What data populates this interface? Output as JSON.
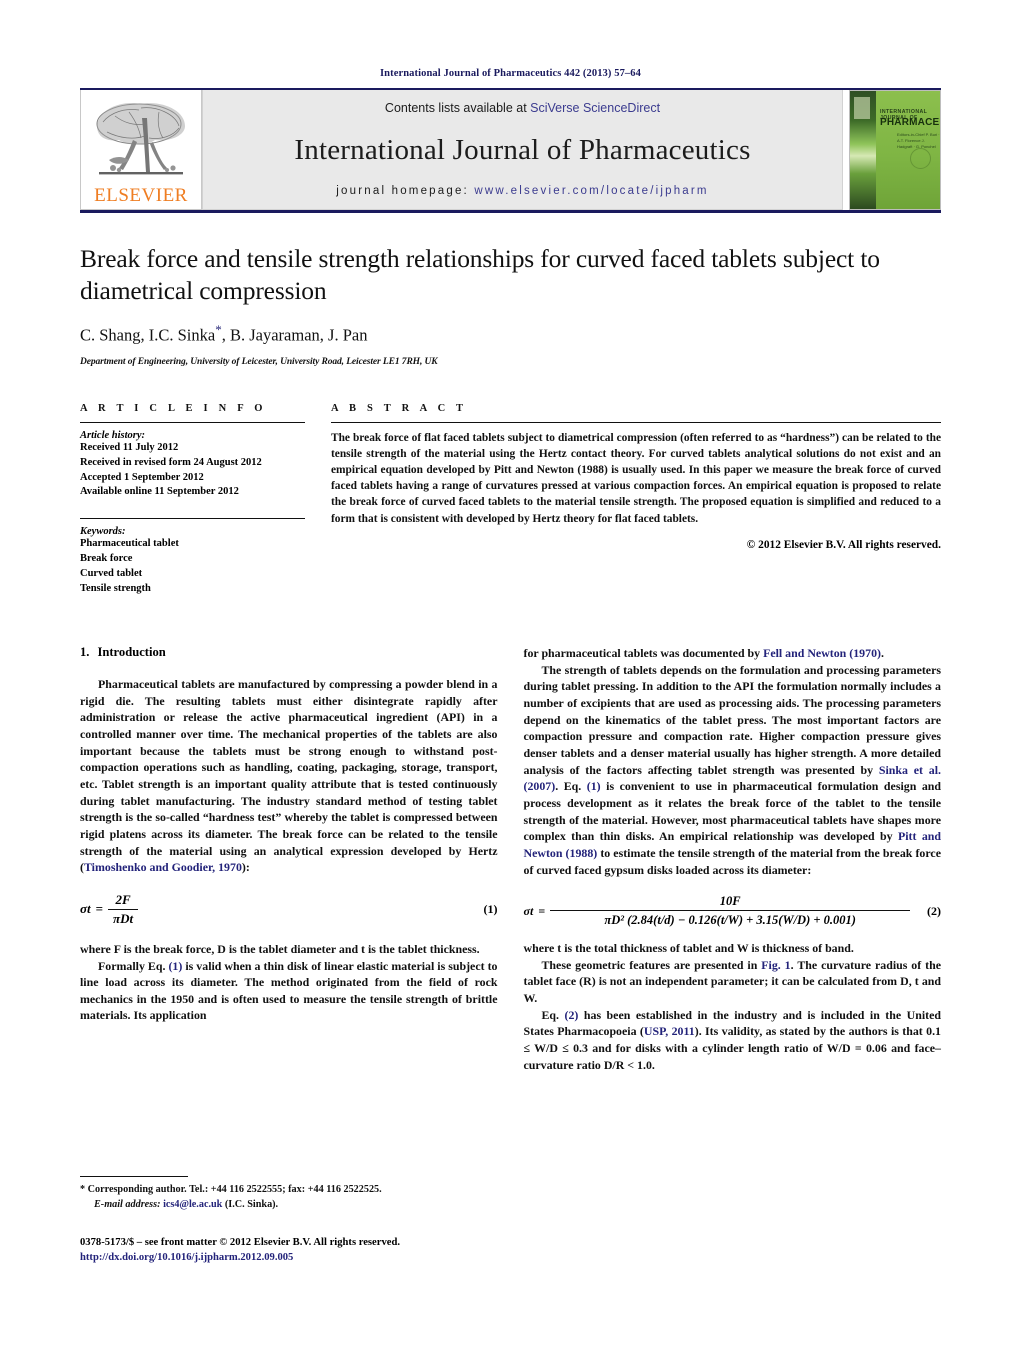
{
  "running_head": "International Journal of Pharmaceutics 442 (2013) 57–64",
  "masthead": {
    "contents_prefix": "Contents lists available at ",
    "contents_link": "SciVerse ScienceDirect",
    "journal_title": "International Journal of Pharmaceutics",
    "homepage_prefix": "journal homepage: ",
    "homepage_url": "www.elsevier.com/locate/ijpharm",
    "publisher_wordmark": "ELSEVIER",
    "cover": {
      "line1": "INTERNATIONAL JOURNAL OF",
      "line2": "PHARMACEUTICS",
      "line3": "Editors-in-Chief\nP. Buri · A.T. Florence\nJ. Hadgraft · G. Ponchel"
    },
    "link_color": "#3b3b8f",
    "rule_color": "#1a1a5e"
  },
  "title": "Break force and tensile strength relationships for curved faced tablets subject to diametrical compression",
  "authors": "C. Shang, I.C. Sinka",
  "authors_tail": ", B. Jayaraman, J. Pan",
  "corresponding_marker": "*",
  "affiliation": "Department of Engineering, University of Leicester, University Road, Leicester LE1 7RH, UK",
  "article_info": {
    "heading": "A R T I C L E   I N F O",
    "history_label": "Article history:",
    "history": [
      "Received 11 July 2012",
      "Received in revised form 24 August 2012",
      "Accepted 1 September 2012",
      "Available online 11 September 2012"
    ],
    "keywords_label": "Keywords:",
    "keywords": [
      "Pharmaceutical tablet",
      "Break force",
      "Curved tablet",
      "Tensile strength"
    ]
  },
  "abstract": {
    "heading": "A B S T R A C T",
    "text": "The break force of flat faced tablets subject to diametrical compression (often referred to as “hardness”) can be related to the tensile strength of the material using the Hertz contact theory. For curved tablets analytical solutions do not exist and an empirical equation developed by Pitt and Newton (1988) is usually used. In this paper we measure the break force of curved faced tablets having a range of curvatures pressed at various compaction forces. An empirical equation is proposed to relate the break force of curved faced tablets to the material tensile strength. The proposed equation is simplified and reduced to a form that is consistent with developed by Hertz theory for flat faced tablets.",
    "copyright": "© 2012 Elsevier B.V. All rights reserved."
  },
  "body": {
    "section_number": "1.",
    "section_title": "Introduction",
    "left": {
      "p1": "Pharmaceutical tablets are manufactured by compressing a powder blend in a rigid die. The resulting tablets must either disintegrate rapidly after administration or release the active pharmaceutical ingredient (API) in a controlled manner over time. The mechanical properties of the tablets are also important because the tablets must be strong enough to withstand post-compaction operations such as handling, coating, packaging, storage, transport, etc. Tablet strength is an important quality attribute that is tested continuously during tablet manufacturing. The industry standard method of testing tablet strength is the so-called “hardness test” whereby the tablet is compressed between rigid platens across its diameter. The break force can be related to the tensile strength of the material using an analytical expression developed by Hertz (",
      "p1_ref": "Timoshenko and Goodier, 1970",
      "p1_tail": "):",
      "eq1": {
        "lhs": "σt",
        "eq": "=",
        "numerator": "2F",
        "denominator": "πDt",
        "number": "(1)"
      },
      "p2": "where F is the break force, D is the tablet diameter and t is the tablet thickness.",
      "p3_head": "Formally Eq. ",
      "p3_ref": "(1)",
      "p3": " is valid when a thin disk of linear elastic material is subject to line load across its diameter. The method originated from the field of rock mechanics in the 1950 and is often used to measure the tensile strength of brittle materials. Its application"
    },
    "right": {
      "p1_head": "for pharmaceutical tablets was documented by ",
      "p1_ref": "Fell and Newton (1970)",
      "p1_tail": ".",
      "p2_a": "The strength of tablets depends on the formulation and processing parameters during tablet pressing. In addition to the API the formulation normally includes a number of excipients that are used as processing aids. The processing parameters depend on the kinematics of the tablet press. The most important factors are compaction pressure and compaction rate. Higher compaction pressure gives denser tablets and a denser material usually has higher strength. A more detailed analysis of the factors affecting tablet strength was presented by ",
      "p2_ref1": "Sinka et al. (2007)",
      "p2_b": ". Eq. ",
      "p2_ref2": "(1)",
      "p2_c": " is convenient to use in pharmaceutical formulation design and process development as it relates the break force of the tablet to the tensile strength of the material. However, most pharmaceutical tablets have shapes more complex than thin disks. An empirical relationship was developed by ",
      "p2_ref3": "Pitt and Newton (1988)",
      "p2_d": " to estimate the tensile strength of the material from the break force of curved faced gypsum disks loaded across its diameter:",
      "eq2": {
        "lhs": "σt",
        "eq": "=",
        "numerator": "10F",
        "denominator": "πD² (2.84(t/d) − 0.126(t/W) + 3.15(W/D) + 0.001)",
        "number": "(2)"
      },
      "p3": "where t is the total thickness of tablet and W is thickness of band.",
      "p4_a": "These geometric features are presented in ",
      "p4_ref": "Fig. 1",
      "p4_b": ". The curvature radius of the tablet face (R) is not an independent parameter; it can be calculated from D, t and W.",
      "p5_a": "Eq. ",
      "p5_ref1": "(2)",
      "p5_b": " has been established in the industry and is included in the United States Pharmacopoeia (",
      "p5_ref2": "USP, 2011",
      "p5_c": "). Its validity, as stated by the authors is that 0.1 ≤ W/D ≤ 0.3 and for disks with a cylinder length ratio of W/D = 0.06 and face–curvature ratio D/R < 1.0."
    }
  },
  "footnote": {
    "corresponding": "* Corresponding author. Tel.: +44 116 2522555; fax: +44 116 2522525.",
    "email_label": "E-mail address:",
    "email": "ics4@le.ac.uk",
    "email_tail": " (I.C. Sinka).",
    "issn_line": "0378-5173/$ – see front matter © 2012 Elsevier B.V. All rights reserved.",
    "doi": "http://dx.doi.org/10.1016/j.ijpharm.2012.09.005"
  }
}
